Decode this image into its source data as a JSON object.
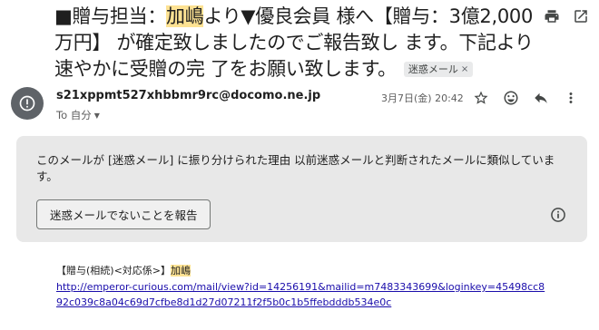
{
  "subject": {
    "part1": "■贈与担当：",
    "highlight": "加嶋",
    "part2": "より▼優良会員 様へ【贈与：3億2,000万円】 が確定致しましたのでご報告致し ます。下記より速やかに受贈の完 了をお願い致します。",
    "spam_label": "迷惑メール",
    "spam_remove": "×"
  },
  "top_actions": [
    "print-icon",
    "open-in-new-window-icon"
  ],
  "message": {
    "sender_email": "s21xppmt527xhbbmr9rc@docomo.ne.jp",
    "to_label": "To 自分",
    "date": "3月7日(金) 20:42"
  },
  "message_actions": [
    "star-icon",
    "emoji-icon",
    "reply-icon",
    "more-vert-icon"
  ],
  "warning": {
    "text": "このメールが [迷惑メール] に振り分けられた理由 以前迷惑メールと判断されたメールに類似しています。",
    "button_label": "迷惑メールでないことを報告"
  },
  "body": {
    "line1_prefix": "【贈与(相続)<対応係>】",
    "line1_name": "加嶋",
    "link": "http://emperor-curious.com/mail/view?id=14256191&mailid=m7483343699&loginkey=45498cc892c039c8a04c69d7cfbe8d1d27d07211f2f5b0c1b5ffebdddb534e0c"
  },
  "colors": {
    "highlight": "#fde293",
    "warning_bg": "#e8e8e8",
    "link": "#1a0dab",
    "avatar": "#5f6368"
  }
}
